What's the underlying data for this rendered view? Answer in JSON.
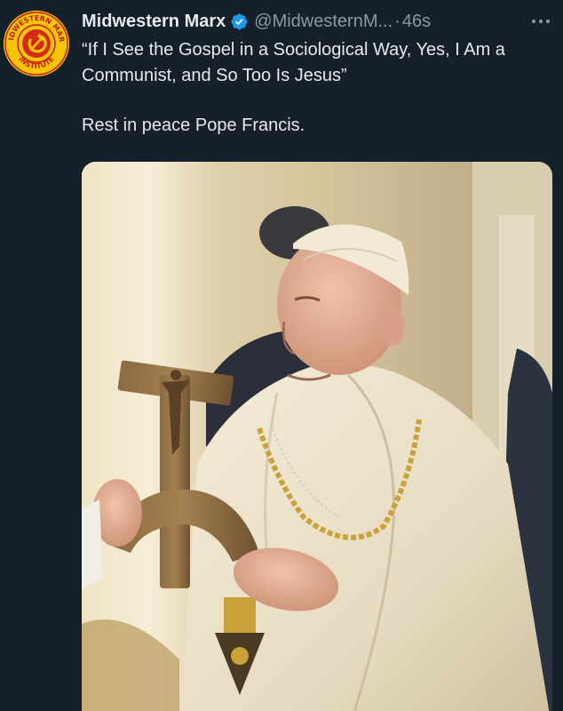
{
  "tweet": {
    "author": {
      "display_name": "Midwestern Marx",
      "handle": "@MidwesternM...",
      "verified_icon": "verified-badge-icon",
      "avatar": {
        "ring_text_top": "MIDWESTERN MARX",
        "ring_text_bottom": "INSTITUTE",
        "icon": "hammer-and-sickle-icon"
      }
    },
    "separator": "·",
    "timestamp": "46s",
    "more_icon": "more-options-icon",
    "text": {
      "paragraph1": "“If I See the Gospel in a Sociological Way, Yes, I Am a Communist, and So Too Is Jesus”",
      "paragraph2": "Rest in peace Pope Francis."
    },
    "media": {
      "type": "photo"
    }
  },
  "colors": {
    "background": "#15202b",
    "text_primary": "#e7e9ea",
    "text_secondary": "#8b98a5",
    "verified_blue": "#1d9bf0",
    "avatar_yellow": "#f7c600",
    "avatar_red": "#d62818"
  }
}
